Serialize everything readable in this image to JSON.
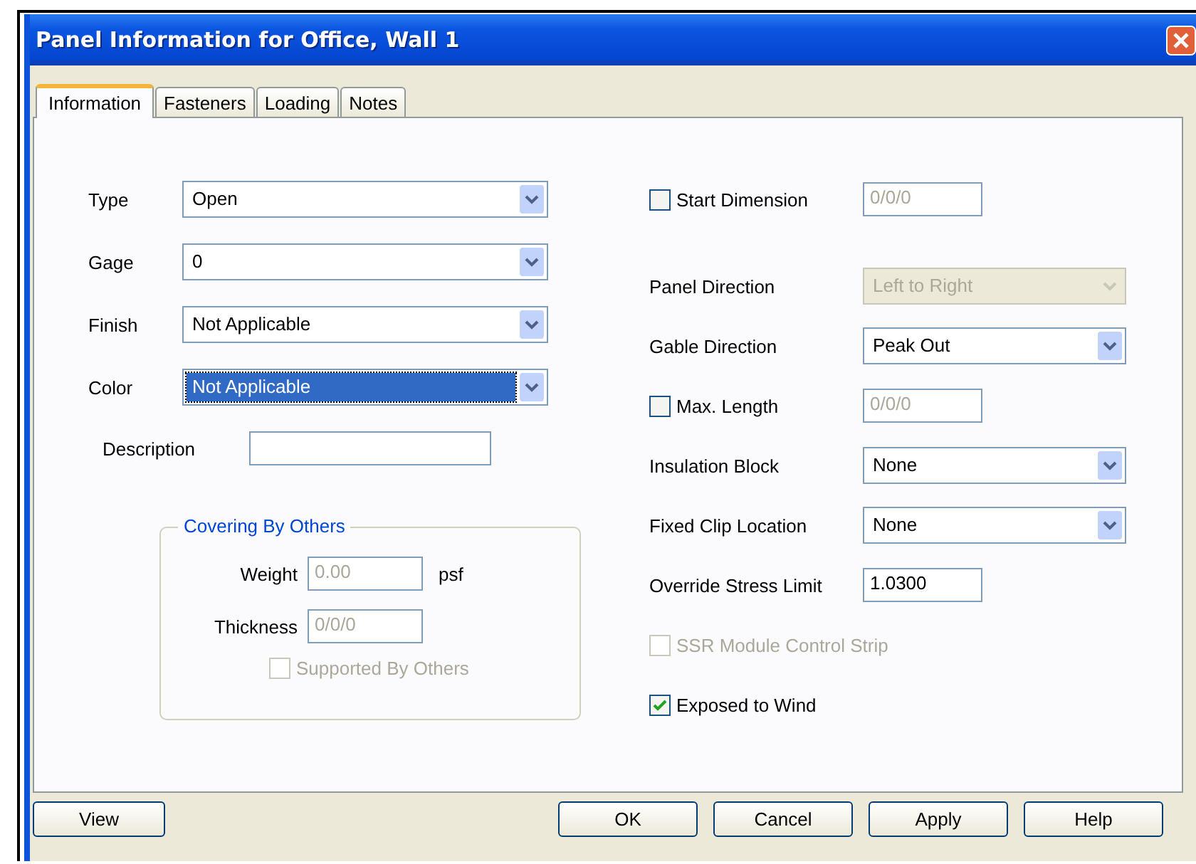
{
  "window": {
    "title": "Panel Information for Office, Wall 1"
  },
  "tabs": [
    {
      "label": "Information",
      "selected": true
    },
    {
      "label": "Fasteners",
      "selected": false
    },
    {
      "label": "Loading",
      "selected": false
    },
    {
      "label": "Notes",
      "selected": false
    }
  ],
  "left_fields": [
    {
      "kind": "dropdown",
      "label": "Type",
      "value": "Open",
      "focused": false
    },
    {
      "kind": "dropdown",
      "label": "Gage",
      "value": "0",
      "focused": false
    },
    {
      "kind": "dropdown",
      "label": "Finish",
      "value": "Not Applicable",
      "focused": false
    },
    {
      "kind": "dropdown",
      "label": "Color",
      "value": "Not Applicable",
      "focused": true
    },
    {
      "kind": "text",
      "label": "Description"
    }
  ],
  "covering_by_others": {
    "title": "Covering By Others",
    "disabled": true,
    "weight": {
      "label": "Weight",
      "value": "0.00",
      "unit": "psf"
    },
    "thickness": {
      "label": "Thickness",
      "value": "0/0/0"
    },
    "supported_by_others": {
      "label": "Supported By Others",
      "checked": false
    }
  },
  "right_fields": [
    {
      "kind": "check_text",
      "label": "Start Dimension",
      "checked": false,
      "value": "0/0/0",
      "disabled": true
    },
    {
      "kind": "dropdown",
      "label": "Panel Direction",
      "value": "Left to Right",
      "disabled": true
    },
    {
      "kind": "dropdown",
      "label": "Gable Direction",
      "value": "Peak Out",
      "disabled": false
    },
    {
      "kind": "check_text",
      "label": "Max. Length",
      "checked": false,
      "value": "0/0/0",
      "disabled": true
    },
    {
      "kind": "dropdown",
      "label": "Insulation Block",
      "value": "None",
      "disabled": false
    },
    {
      "kind": "dropdown",
      "label": "Fixed Clip Location",
      "value": "None",
      "disabled": false
    },
    {
      "kind": "text",
      "label": "Override Stress Limit",
      "value": "1.0300",
      "disabled": false
    },
    {
      "kind": "checkbox",
      "label": "SSR Module Control Strip",
      "checked": false,
      "disabled": true
    },
    {
      "kind": "checkbox",
      "label": "Exposed to Wind",
      "checked": true,
      "disabled": false
    }
  ],
  "buttons": [
    {
      "label": "View"
    },
    {
      "label": "OK"
    },
    {
      "label": "Cancel"
    },
    {
      "label": "Apply"
    },
    {
      "label": "Help"
    }
  ]
}
